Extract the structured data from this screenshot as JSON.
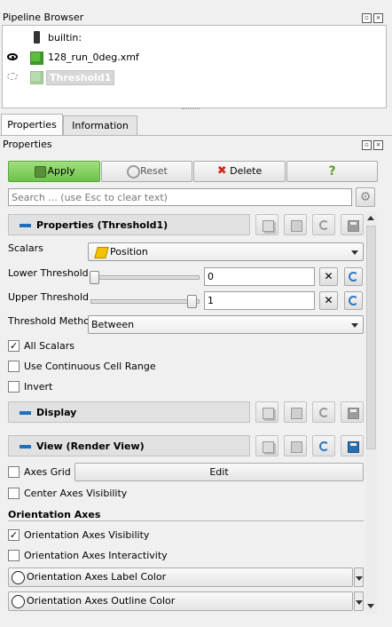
{
  "pipeline": {
    "title": "Pipeline Browser",
    "items": [
      {
        "label": "builtin:",
        "icon": "server-icon"
      },
      {
        "label": "128_run_0deg.xmf",
        "icon": "cube-icon",
        "visible": true
      },
      {
        "label": "Threshold1",
        "icon": "cube-icon",
        "visible": false,
        "selected": true
      }
    ]
  },
  "tabs": [
    {
      "label": "Properties",
      "active": true
    },
    {
      "label": "Information",
      "active": false
    }
  ],
  "properties": {
    "title": "Properties",
    "apply": "Apply",
    "reset": "Reset",
    "delete": "Delete",
    "help": "?",
    "search_placeholder": "Search ... (use Esc to clear text)"
  },
  "sections": {
    "threshold": "Properties (Threshold1)",
    "display": "Display",
    "view": "View (Render View)"
  },
  "fields": {
    "scalars_label": "Scalars",
    "scalars_value": "Position",
    "lower_label": "Lower Threshold",
    "lower_value": "0",
    "lower_fraction": 0.0,
    "upper_label": "Upper Threshold",
    "upper_value": "1",
    "upper_fraction": 1.0,
    "method_label": "Threshold Method",
    "method_value": "Between"
  },
  "checkboxes": {
    "all_scalars": {
      "label": "All Scalars",
      "checked": true
    },
    "continuous": {
      "label": "Use Continuous Cell Range",
      "checked": false
    },
    "invert": {
      "label": "Invert",
      "checked": false
    }
  },
  "view": {
    "axes_grid": {
      "label": "Axes Grid",
      "checked": false
    },
    "edit": "Edit",
    "center_axes": {
      "label": "Center Axes Visibility",
      "checked": false
    },
    "orientation_header": "Orientation Axes",
    "orientation_visibility": {
      "label": "Orientation Axes Visibility",
      "checked": true
    },
    "orientation_interactivity": {
      "label": "Orientation Axes Interactivity",
      "checked": false
    },
    "label_color": "Orientation Axes Label Color",
    "outline_color": "Orientation Axes Outline Color"
  },
  "colors": {
    "apply_green": "#7ccf57",
    "accent_blue": "#1f6fb9",
    "delete_red": "#d9261c"
  }
}
